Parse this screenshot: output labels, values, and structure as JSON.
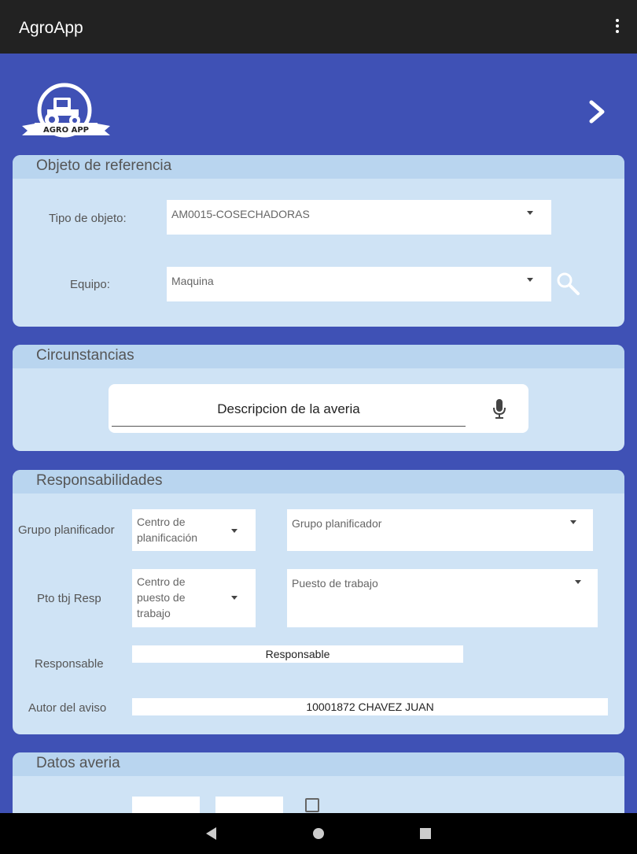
{
  "appbar": {
    "title": "AgroApp"
  },
  "logo": {
    "text": "AGRO APP"
  },
  "objeto": {
    "title": "Objeto de referencia",
    "tipo_label": "Tipo de objeto:",
    "tipo_value": "AM0015-COSECHADORAS",
    "equipo_label": "Equipo:",
    "equipo_value": "Maquina"
  },
  "circunstancias": {
    "title": "Circunstancias",
    "descripcion_placeholder": "Descripcion de la averia"
  },
  "responsabilidades": {
    "title": "Responsabilidades",
    "grupo_label": "Grupo planificador",
    "centro_planificacion": "Centro de planificación",
    "grupo_value": "Grupo planificador",
    "pto_label": "Pto tbj Resp",
    "centro_puesto": "Centro de puesto de trabajo",
    "puesto_value": "Puesto de trabajo",
    "responsable_label": "Responsable",
    "responsable_value": "Responsable",
    "autor_label": "Autor del aviso",
    "autor_value": "10001872 CHAVEZ JUAN"
  },
  "datos": {
    "title": "Datos averia"
  },
  "colors": {
    "appbar": "#222222",
    "primary": "#3f51b5",
    "card": "#cfe3f5",
    "card_header": "#b9d5ef"
  },
  "icons": [
    "tractor-logo-icon",
    "chevron-right-icon",
    "overflow-menu-icon",
    "search-icon",
    "microphone-icon",
    "back-icon",
    "home-icon",
    "recents-icon"
  ]
}
